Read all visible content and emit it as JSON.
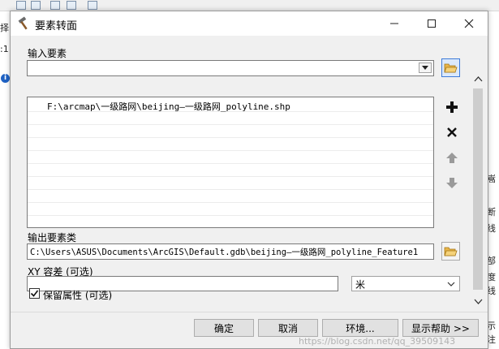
{
  "dialog": {
    "title": "要素转面"
  },
  "form": {
    "input_features_label": "输入要素",
    "input_features_value": "",
    "list_items": [
      "F:\\arcmap\\一级路网\\beijing—一级路网_polyline.shp"
    ],
    "output_label": "输出要素类",
    "output_value": "C:\\Users\\ASUS\\Documents\\ArcGIS\\Default.gdb\\beijing—一级路网_polyline_Feature1",
    "xy_tolerance_label": "XY 容差 (可选)",
    "xy_tolerance_value": "",
    "unit_value": "米",
    "preserve_attributes_label": "保留属性 (可选)",
    "preserve_attributes_checked": true
  },
  "buttons": {
    "ok": "确定",
    "cancel": "取消",
    "environments": "环境...",
    "show_help": "显示帮助 >>"
  },
  "background": {
    "left_texts": [
      "择",
      ":1"
    ],
    "right_texts": [
      "嵩",
      "断",
      "线",
      "部",
      "度",
      "线",
      "示",
      "注"
    ]
  },
  "watermark": "https://blog.csdn.net/qq_39509143"
}
